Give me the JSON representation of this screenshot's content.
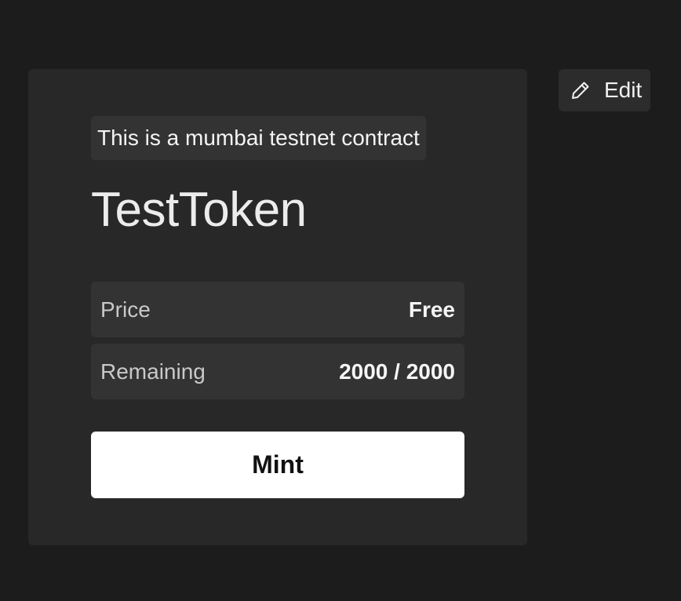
{
  "card": {
    "notice": "This is a mumbai testnet contract",
    "title": "TestToken",
    "details": [
      {
        "label": "Price",
        "value": "Free"
      },
      {
        "label": "Remaining",
        "value": "2000 / 2000"
      }
    ],
    "mint_label": "Mint"
  },
  "edit": {
    "label": "Edit",
    "icon": "pencil-icon"
  }
}
